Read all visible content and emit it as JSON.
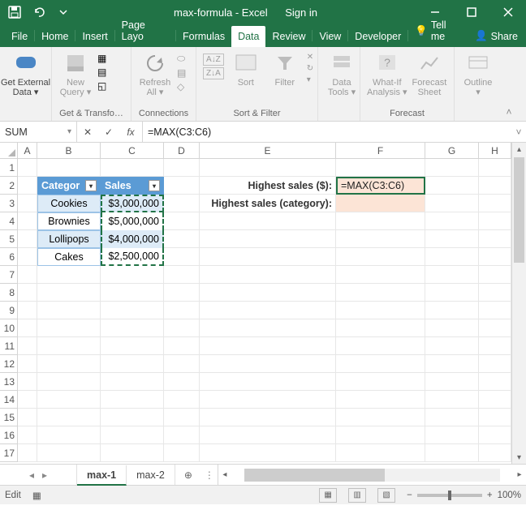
{
  "titlebar": {
    "title": "max-formula - Excel",
    "signin": "Sign in"
  },
  "tabs": {
    "file": "File",
    "home": "Home",
    "insert": "Insert",
    "pagelayout": "Page Layo",
    "formulas": "Formulas",
    "data": "Data",
    "review": "Review",
    "view": "View",
    "developer": "Developer",
    "tellme": "Tell me",
    "share": "Share"
  },
  "ribbon": {
    "get_external_data": "Get External\nData ▾",
    "new_query": "New\nQuery ▾",
    "refresh_all": "Refresh\nAll ▾",
    "sort": "Sort",
    "filter": "Filter",
    "data_tools": "Data\nTools ▾",
    "whatif": "What-If\nAnalysis ▾",
    "forecast_sheet": "Forecast\nSheet",
    "outline": "Outline\n▾",
    "group_get_transform": "Get & Transfo…",
    "group_connections": "Connections",
    "group_sort_filter": "Sort & Filter",
    "group_forecast": "Forecast"
  },
  "formula_bar": {
    "name": "SUM",
    "formula": "=MAX(C3:C6)"
  },
  "columns": [
    "A",
    "B",
    "C",
    "D",
    "E",
    "F",
    "G",
    "H"
  ],
  "rows": [
    "1",
    "2",
    "3",
    "4",
    "5",
    "6",
    "7",
    "8",
    "9",
    "10",
    "11",
    "12",
    "13",
    "14",
    "15",
    "16",
    "17"
  ],
  "table": {
    "hdr_b": "Categor",
    "hdr_c": "Sales",
    "b3": "Cookies",
    "c3": "$3,000,000",
    "b4": "Brownies",
    "c4": "$5,000,000",
    "b5": "Lollipops",
    "c5": "$4,000,000",
    "b6": "Cakes",
    "c6": "$2,500,000"
  },
  "labels": {
    "e2": "Highest sales ($):",
    "e3": "Highest sales (category):",
    "f2": "=MAX(C3:C6)"
  },
  "sheets": {
    "s1": "max-1",
    "s2": "max-2"
  },
  "status": {
    "mode": "Edit",
    "zoom": "100%"
  }
}
